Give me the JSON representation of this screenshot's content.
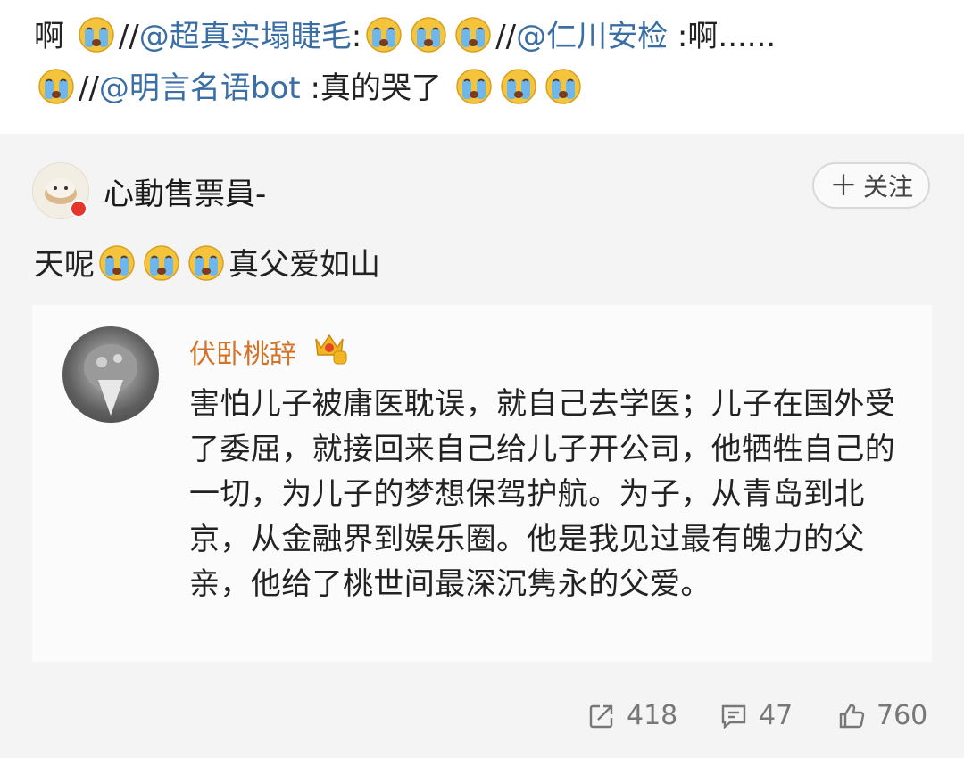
{
  "repost_chain": {
    "line1": {
      "lead_text": "啊",
      "sep1": "//",
      "mention1": "@超真实塌睫毛",
      "colon1": ":",
      "sep2": "//",
      "mention2": "@仁川安检",
      "text2": " :啊......"
    },
    "line2": {
      "sep": "//",
      "mention": "@明言名语bot",
      "text": " :真的哭了"
    }
  },
  "comment": {
    "author": "心動售票員-",
    "follow_label": "关注",
    "text_before": "天呢",
    "text_after": "真父爱如山"
  },
  "quoted_post": {
    "author": "伏卧桃辞",
    "body": "害怕儿子被庸医耽误，就自己去学医；儿子在国外受了委屈，就接回来自己给儿子开公司，他牺牲自己的一切，为儿子的梦想保驾护航。为子，从青岛到北京，从金融界到娱乐圈。他是我见过最有魄力的父亲，他给了桃世间最深沉隽永的父爱。"
  },
  "actions": {
    "repost_count": "418",
    "comment_count": "47",
    "like_count": "760"
  },
  "icons": [
    "crying-emoji-icon",
    "plus-icon",
    "crown-level-icon",
    "repost-icon",
    "comment-icon",
    "like-icon"
  ],
  "colors": {
    "mention": "#3a6ea5",
    "quoted_author": "#d2732a",
    "card_bg": "#f4f4f4"
  }
}
